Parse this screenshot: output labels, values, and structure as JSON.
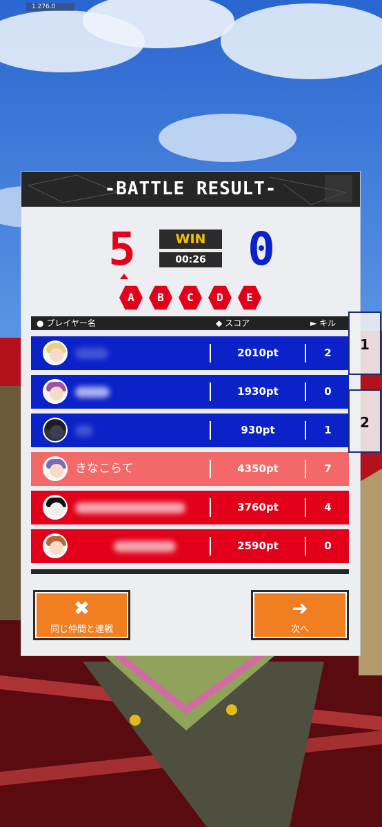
{
  "version": "1.276.0",
  "header": {
    "title": "-BATTLE RESULT-"
  },
  "score": {
    "left": "5",
    "right": "0",
    "result": "WIN",
    "time": "00:26"
  },
  "zones": [
    "A",
    "B",
    "C",
    "D",
    "E"
  ],
  "columns": {
    "player": "プレイヤー名",
    "score": "スコア",
    "kills": "キル"
  },
  "players": [
    {
      "team": "blue",
      "name": "",
      "score": "2010pt",
      "kills": "2"
    },
    {
      "team": "blue",
      "name": "",
      "score": "1930pt",
      "kills": "0"
    },
    {
      "team": "blue",
      "name": "",
      "score": "930pt",
      "kills": "1"
    },
    {
      "team": "red",
      "name": "きなこらて",
      "score": "4350pt",
      "kills": "7",
      "self": true
    },
    {
      "team": "red",
      "name": "",
      "score": "3760pt",
      "kills": "4"
    },
    {
      "team": "red",
      "name": "",
      "score": "2590pt",
      "kills": "0"
    }
  ],
  "buttons": {
    "team_battle": "同じ仲間と連戦",
    "next": "次へ"
  },
  "side_tabs": [
    "1",
    "2"
  ],
  "colors": {
    "red_team": "#e2001a",
    "blue_team": "#0b22c9",
    "self_row": "#f36969",
    "button": "#f17f22",
    "win": "#f2c200"
  }
}
